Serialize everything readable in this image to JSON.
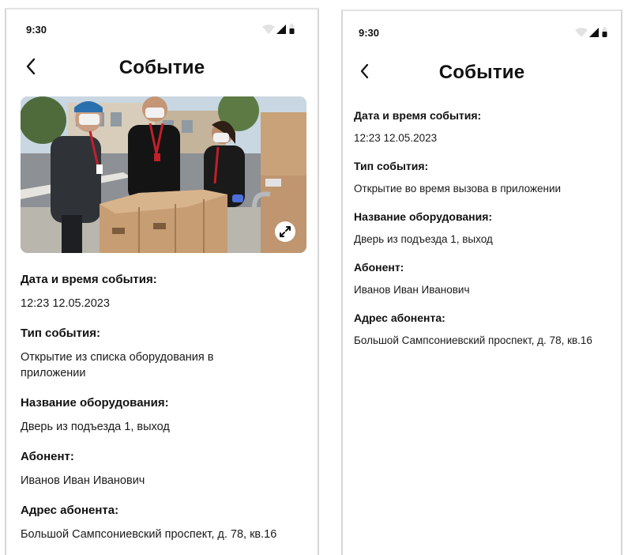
{
  "screens": [
    {
      "status_time": "9:30",
      "title": "Событие",
      "has_photo": true,
      "fields": [
        {
          "label": "Дата и время события:",
          "value": "12:23 12.05.2023"
        },
        {
          "label": "Тип события:",
          "value": "Открытие из списка оборудования в приложении"
        },
        {
          "label": "Название оборудования:",
          "value": "Дверь из подъезда 1, выход"
        },
        {
          "label": "Абонент:",
          "value": "Иванов Иван Иванович"
        },
        {
          "label": "Адрес абонента:",
          "value": "Большой Сампсониевский проспект, д. 78, кв.16"
        }
      ]
    },
    {
      "status_time": "9:30",
      "title": "Событие",
      "has_photo": false,
      "fields": [
        {
          "label": "Дата и время события:",
          "value": "12:23 12.05.2023"
        },
        {
          "label": "Тип события:",
          "value": "Открытие во время вызова в приложении"
        },
        {
          "label": "Название оборудования:",
          "value": "Дверь из подъезда 1, выход"
        },
        {
          "label": "Абонент:",
          "value": "Иванов Иван Иванович"
        },
        {
          "label": "Адрес абонента:",
          "value": "Большой Сампсониевский проспект, д. 78, кв.16"
        }
      ]
    }
  ],
  "icons": {
    "back": "chevron-left-icon",
    "expand": "expand-arrows-icon",
    "wifi": "wifi-icon",
    "cellular": "cellular-signal-icon",
    "battery": "battery-icon"
  },
  "colors": {
    "text": "#111111",
    "border": "#d6d6d6",
    "background": "#ffffff"
  }
}
